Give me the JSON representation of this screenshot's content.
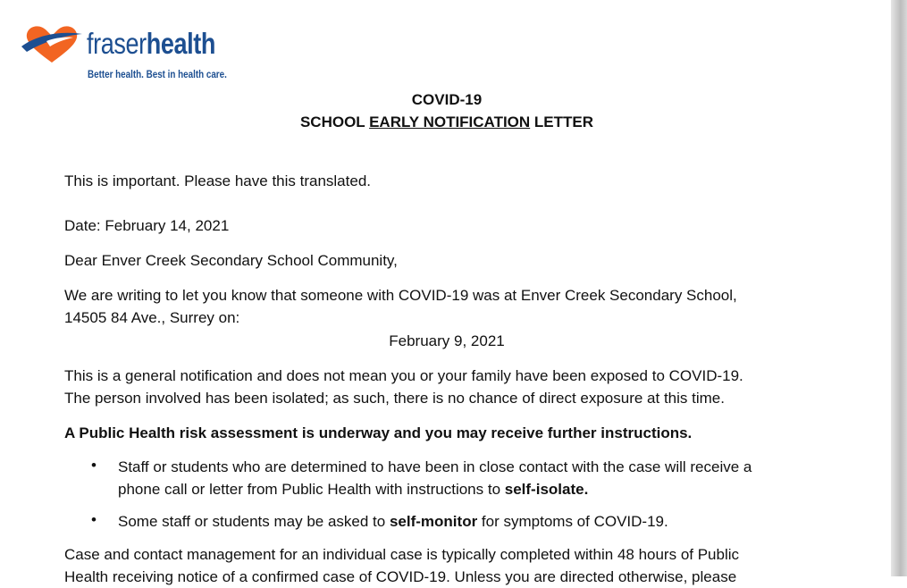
{
  "logo": {
    "brand_light": "fraser",
    "brand_bold": "health",
    "tagline": "Better health. Best in health care."
  },
  "title": {
    "line1": "COVID-19",
    "line2_pre": "SCHOOL ",
    "line2_underlined": "EARLY NOTIFICATION",
    "line2_post": " LETTER"
  },
  "body": {
    "important": "This is important. Please have this translated.",
    "date": "Date: February 14, 2021",
    "greeting": "Dear Enver Creek Secondary School Community,",
    "writing_line1": "We are writing to let you know that someone with COVID-19 was at Enver Creek Secondary School,",
    "writing_line2": "14505 84 Ave., Surrey on:",
    "exposure_date": "February 9, 2021",
    "general_line1": "This is a general notification and does not mean you or your family have been exposed to COVID-19.",
    "general_line2": "The person involved has been isolated; as such, there is no chance of direct exposure at this time.",
    "assessment": "A Public Health risk assessment is underway and you may receive further instructions.",
    "bullets": [
      {
        "line1": "Staff or students who are determined to have been in close contact with the case will receive a",
        "line2_pre": "phone call or letter from Public Health with instructions to ",
        "line2_bold": "self-isolate."
      },
      {
        "pre": "Some staff or students may be asked to ",
        "bold": "self-monitor",
        "post": " for symptoms of COVID-19."
      }
    ],
    "case_line1": "Case and contact management for an individual case is typically completed within 48 hours of Public",
    "case_line2": "Health receiving notice of a confirmed case of COVID-19. Unless you are directed otherwise, please"
  },
  "colors": {
    "brand_blue": "#1d4f91",
    "brand_orange": "#f26522"
  }
}
